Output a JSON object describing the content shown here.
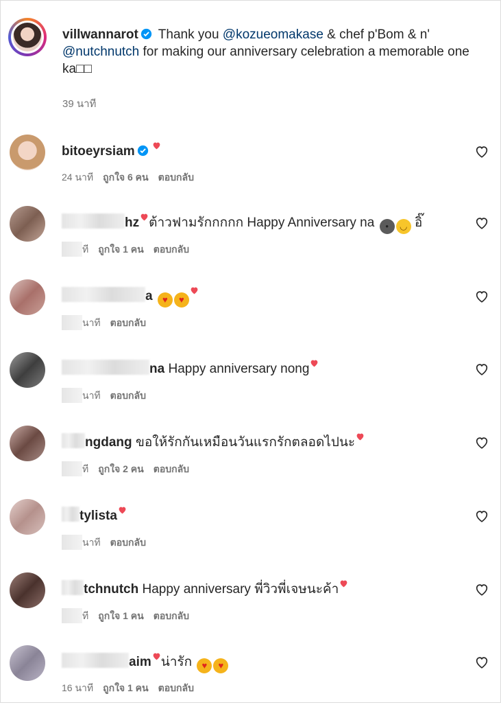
{
  "post": {
    "username": "villwannarot",
    "text_before": " Thank you ",
    "mention1": "@kozueomakase",
    "text_mid": " & chef p'Bom & n' ",
    "mention2": "@nutchnutch",
    "text_after": " for making our anniversary celebration a memorable one ka□□",
    "time": "39 นาที"
  },
  "comments": [
    {
      "username": "bitoeyrsiam",
      "text": "",
      "time": "24 นาที",
      "likes": "ถูกใจ 6 คน",
      "reply": "ตอบกลับ",
      "avatar_color": "#d9b08f"
    },
    {
      "username": "hz",
      "text": "ต้าวฟามรักกกกก Happy Anniversary na",
      "time": "ที",
      "likes": "ถูกใจ 1 คน",
      "reply": "ตอบกลับ",
      "avatar_color": "#9d7b6c"
    },
    {
      "username": "a",
      "text": "",
      "time": "นาที",
      "likes": "",
      "reply": "ตอบกลับ",
      "avatar_color": "#b68a80"
    },
    {
      "username": "na",
      "text": "Happy anniversary nong",
      "time": "นาที",
      "likes": "",
      "reply": "ตอบกลับ",
      "avatar_color": "#5a5a5a"
    },
    {
      "username": "ngdang",
      "text": "ขอให้รักกันเหมือนวันแรกรักตลอดไปนะ",
      "time": "ที",
      "likes": "ถูกใจ 2 คน",
      "reply": "ตอบกลับ",
      "avatar_color": "#7b5c55"
    },
    {
      "username": "tylista",
      "text": "",
      "time": "นาที",
      "likes": "",
      "reply": "ตอบกลับ",
      "avatar_color": "#c9a39c"
    },
    {
      "username": "tchnutch",
      "text": "Happy anniversary พี่วิวพี่เจษนะค้า",
      "time": "ที",
      "likes": "ถูกใจ 1 คน",
      "reply": "ตอบกลับ",
      "avatar_color": "#5b4440"
    },
    {
      "username": "aim",
      "text": "น่ารัก",
      "time": "16 นาที",
      "likes": "ถูกใจ 1 คน",
      "reply": "ตอบกลับ",
      "avatar_color": "#a9a3b3"
    }
  ],
  "colors": {
    "verified": "#0095f6",
    "heart_red": "#ed4956",
    "mention": "#00376b",
    "muted": "#737373"
  },
  "icons": {
    "like": "heart-outline-icon",
    "verified": "verified-badge-icon"
  }
}
